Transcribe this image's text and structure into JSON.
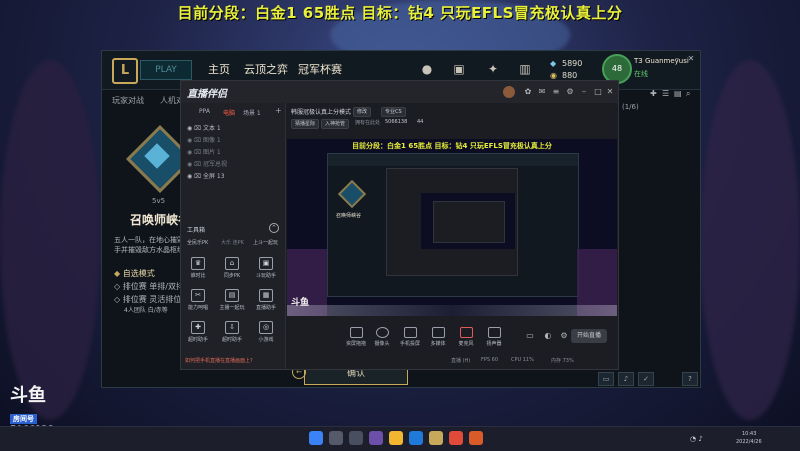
{
  "banner": "目前分段：白金1 65胜点 目标：钻4 只玩EFLS冒充极认真上分",
  "lol": {
    "play": "PLAY",
    "nav": [
      "主页",
      "云顶之弈",
      "冠军杯赛"
    ],
    "currency": [
      "5890",
      "880"
    ],
    "avatar_level": "48",
    "username": "T3 Guanmeyusi",
    "status": "在线",
    "subnav": [
      "玩家对战",
      "人机对"
    ],
    "mode_size": "5v5",
    "mode_title": "召唤师峡谷",
    "desc1": "五人一队，在地心摧毁",
    "desc2": "手并摧毁敌方水晶枢纽",
    "options": [
      "自选模式",
      "排位赛 单排/双排",
      "排位赛 灵活排位"
    ],
    "option_note": "4人团队 白/赤等",
    "confirm": "确认",
    "friend_count": "(1/6)"
  },
  "zb": {
    "logo": "直播伴侣",
    "tabs": [
      "PPA",
      "电脑",
      "场景 1"
    ],
    "scenes": [
      "文本 1",
      "图像 1",
      "图片 1",
      "冠军总视",
      "全屏 13"
    ],
    "tools_label": "工具箱",
    "tools_tabs": [
      "全民乐PK",
      "大乐 连PK",
      "上斗一起玩"
    ],
    "tools": [
      "谁时比",
      "同步PK",
      "斗玩助手",
      "能力呵唱",
      "主播一起玩",
      "直播助手",
      "超时助手",
      "小游戏"
    ],
    "title": "韩服冠极认真上分模式",
    "title_chips": [
      "修改",
      "专业CS"
    ],
    "chips": [
      "猜播星际",
      "入神抢管",
      "拥有在此处",
      "5066138",
      "44"
    ],
    "bottom": [
      "资屏拖拖",
      "摄像头",
      "手机投屏",
      "多媒体",
      "麦克风",
      "扬声器"
    ],
    "live_btn": "开始直播",
    "notice": "如何把手机直播在直播画面上?",
    "status": [
      "直播 (H)",
      "FPS 60",
      "CPU 11%",
      "内存 73%"
    ]
  },
  "preview": {
    "banner": "目前分段：白金1 65胜点 目标：钻4 只玩EFLS冒充极认真上分",
    "inner_title": "召唤师峡谷"
  },
  "douyu": {
    "logo": "斗鱼",
    "label": "房间号",
    "room": "5066138"
  },
  "taskbar": {
    "time": "10:43",
    "date": "2022/4/26"
  },
  "colors": {
    "banner": "#e9f03a",
    "gold": "#c8a85a",
    "client_bg": "#0e1419"
  }
}
